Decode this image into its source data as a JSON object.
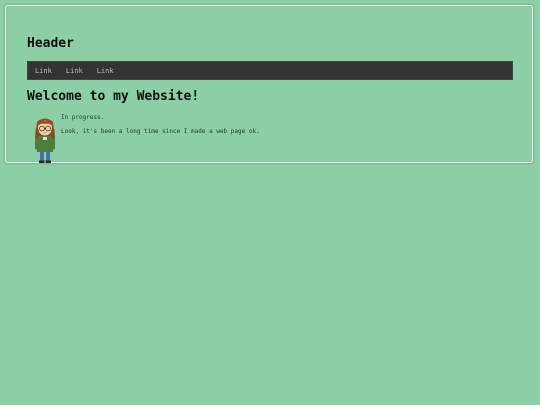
{
  "header": {
    "title": "Header"
  },
  "nav": {
    "links": [
      "Link",
      "Link",
      "Link"
    ]
  },
  "main": {
    "heading": "Welcome to my Website!",
    "status": "In progress.",
    "note": "Look, it's been a long time since I made a web page ok."
  },
  "colors": {
    "page_background": "#8ccea6",
    "navbar_background": "#333333",
    "nav_link_text": "#bdbdbd"
  },
  "icons": {
    "avatar": "pixel-art-character-avatar"
  }
}
